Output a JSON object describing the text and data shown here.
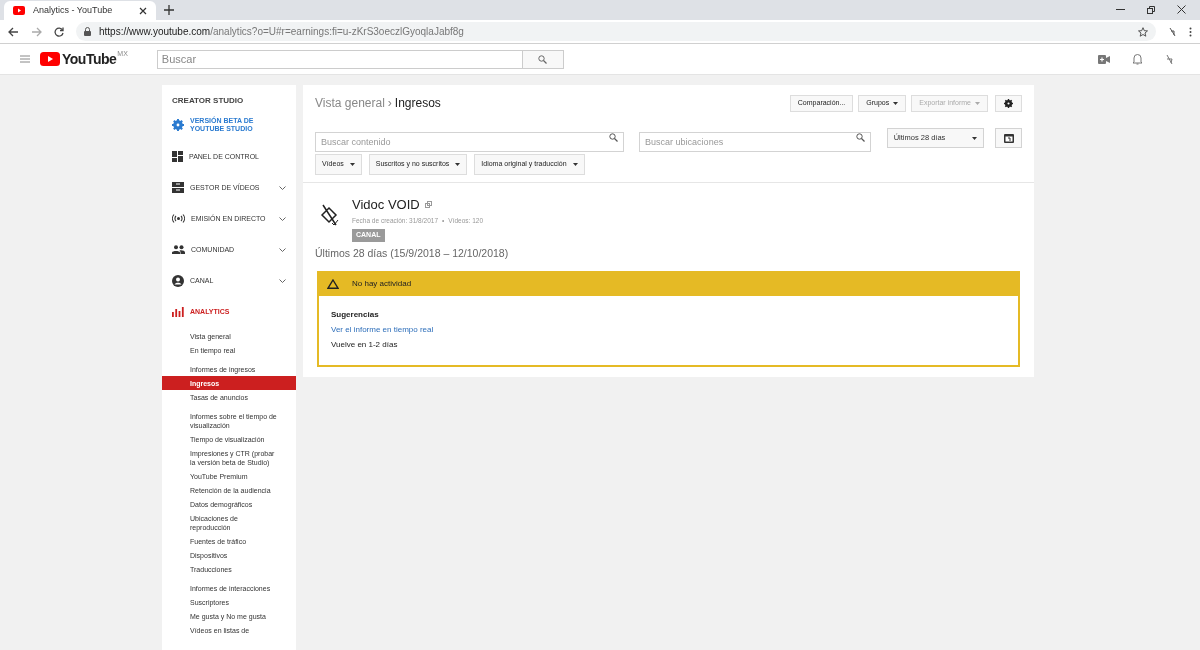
{
  "browser": {
    "tab_title": "Analytics - YouTube",
    "url_host": "https://www.youtube.com",
    "url_path": "/analytics?o=U#r=earnings:fi=u-zKrS3oeczlGyoqlaJabf8g"
  },
  "header": {
    "logo": "YouTube",
    "region": "MX",
    "search": {
      "placeholder": "Buscar"
    }
  },
  "sidebar": {
    "title": "CREATOR STUDIO",
    "nav": [
      {
        "kind": "beta",
        "label": "VERSIÓN BETA DE YOUTUBE STUDIO",
        "expandable": false
      },
      {
        "kind": "nav",
        "label": "PANEL DE CONTROL",
        "expandable": false
      },
      {
        "kind": "nav",
        "label": "GESTOR DE VÍDEOS",
        "expandable": true
      },
      {
        "kind": "nav",
        "label": "EMISIÓN EN DIRECTO",
        "expandable": true
      },
      {
        "kind": "nav",
        "label": "COMUNIDAD",
        "expandable": true
      },
      {
        "kind": "nav",
        "label": "CANAL",
        "expandable": true
      },
      {
        "kind": "active",
        "label": "ANALYTICS",
        "expandable": false
      }
    ],
    "analytics_groups": [
      [
        {
          "label": "Vista general",
          "selected": false
        },
        {
          "label": "En tiempo real",
          "selected": false
        }
      ],
      [
        {
          "label": "Informes de ingresos",
          "selected": false
        },
        {
          "label": "Ingresos",
          "selected": true
        },
        {
          "label": "Tasas de anuncios",
          "selected": false
        }
      ],
      [
        {
          "label": "Informes sobre el tiempo de visualización",
          "selected": false
        },
        {
          "label": "Tiempo de visualización",
          "selected": false
        },
        {
          "label": "Impresiones y CTR (probar la versión beta de Studio)",
          "selected": false
        },
        {
          "label": "YouTube Premium",
          "selected": false
        },
        {
          "label": "Retención de la audiencia",
          "selected": false
        },
        {
          "label": "Datos demográficos",
          "selected": false
        },
        {
          "label": "Ubicaciones de reproducción",
          "selected": false
        },
        {
          "label": "Fuentes de tráfico",
          "selected": false
        },
        {
          "label": "Dispositivos",
          "selected": false
        },
        {
          "label": "Traducciones",
          "selected": false
        }
      ],
      [
        {
          "label": "Informes de interacciones",
          "selected": false
        },
        {
          "label": "Suscriptores",
          "selected": false
        },
        {
          "label": "Me gusta y No me gusta",
          "selected": false
        },
        {
          "label": "Vídeos en listas de",
          "selected": false
        }
      ]
    ]
  },
  "main": {
    "breadcrumb": {
      "parent": "Vista general",
      "separator": "›",
      "current": "Ingresos"
    },
    "actions": [
      {
        "label": "Comparación...",
        "dropdown": false,
        "disabled": false
      },
      {
        "label": "Grupos",
        "dropdown": true,
        "disabled": false
      },
      {
        "label": "Exportar informe",
        "dropdown": true,
        "disabled": true
      }
    ],
    "content_search": {
      "placeholder": "Buscar contenido"
    },
    "location_search": {
      "placeholder": "Buscar ubicaciones"
    },
    "date_range": "Últimos 28 días",
    "filters": [
      "Vídeos",
      "Suscritos y no suscritos",
      "Idioma original y traducción"
    ],
    "channel": {
      "name": "Vidoc VOID",
      "created": "Fecha de creación: 31/8/2017",
      "separator": "•",
      "videos": "Vídeos: 120",
      "badge": "CANAL"
    },
    "period": "Últimos 28 días (15/9/2018 – 12/10/2018)",
    "alert": {
      "title": "No hay actividad",
      "heading": "Sugerencias",
      "link": "Ver el informe en tiempo real",
      "text": "Vuelve en 1-2 días"
    }
  }
}
